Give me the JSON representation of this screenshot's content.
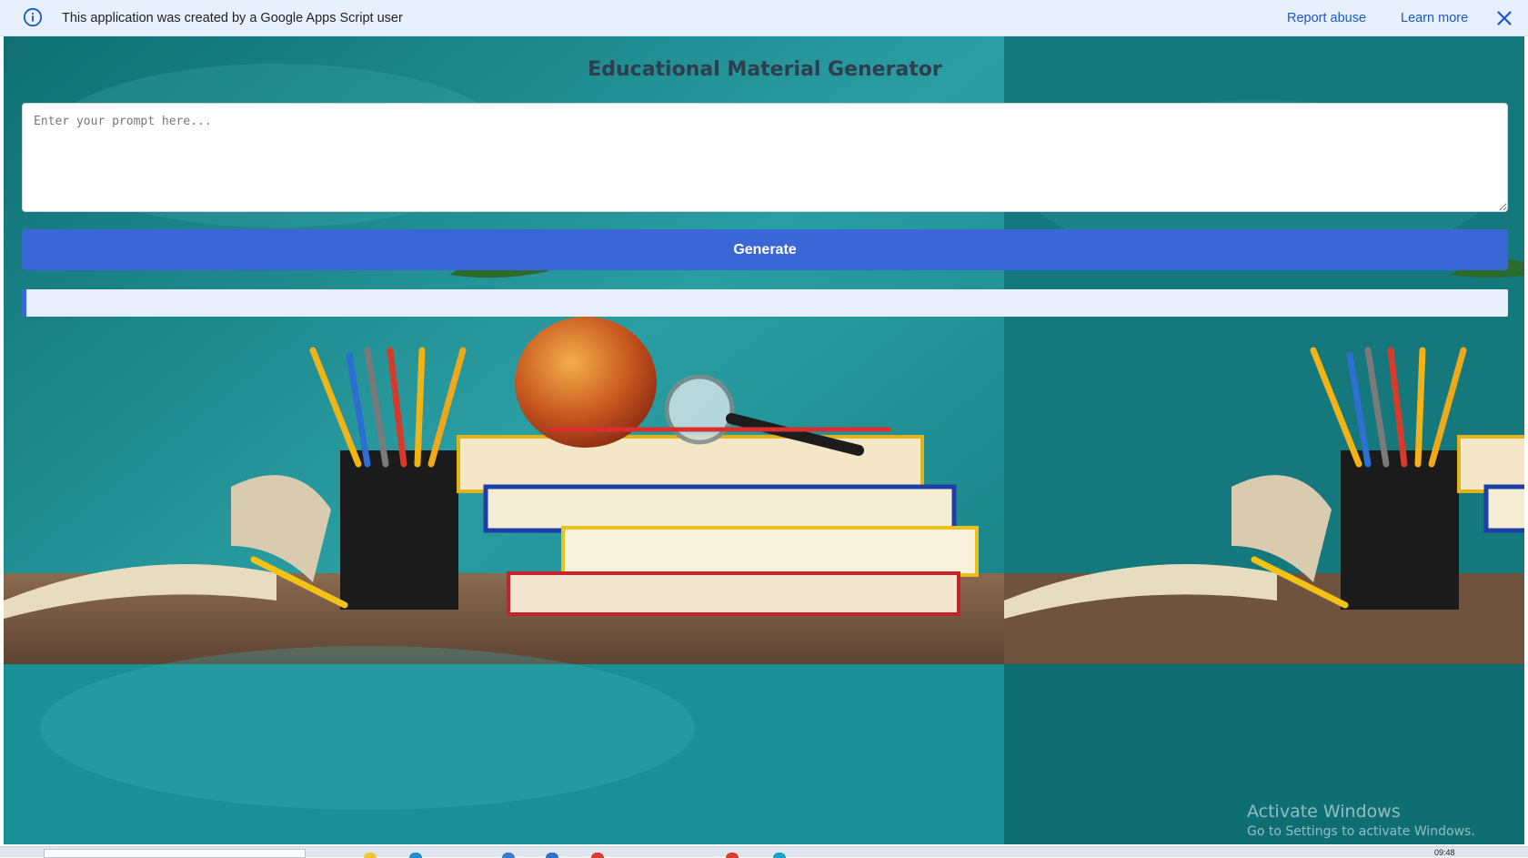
{
  "banner": {
    "icon": "info-icon",
    "text": "This application was created by a Google Apps Script user",
    "report_abuse": "Report abuse",
    "learn_more": "Learn more",
    "close_icon": "close-icon",
    "link_color": "#1a58c5"
  },
  "app": {
    "title": "Educational Material Generator",
    "prompt": {
      "value": "",
      "placeholder": "Enter your prompt here..."
    },
    "generate_label": "Generate",
    "accent_color": "#3b67d6",
    "progress_fraction": 0.003
  },
  "watermark": {
    "title": "Activate Windows",
    "subtitle": "Go to Settings to activate Windows."
  },
  "taskbar": {
    "clock": "09:48"
  }
}
